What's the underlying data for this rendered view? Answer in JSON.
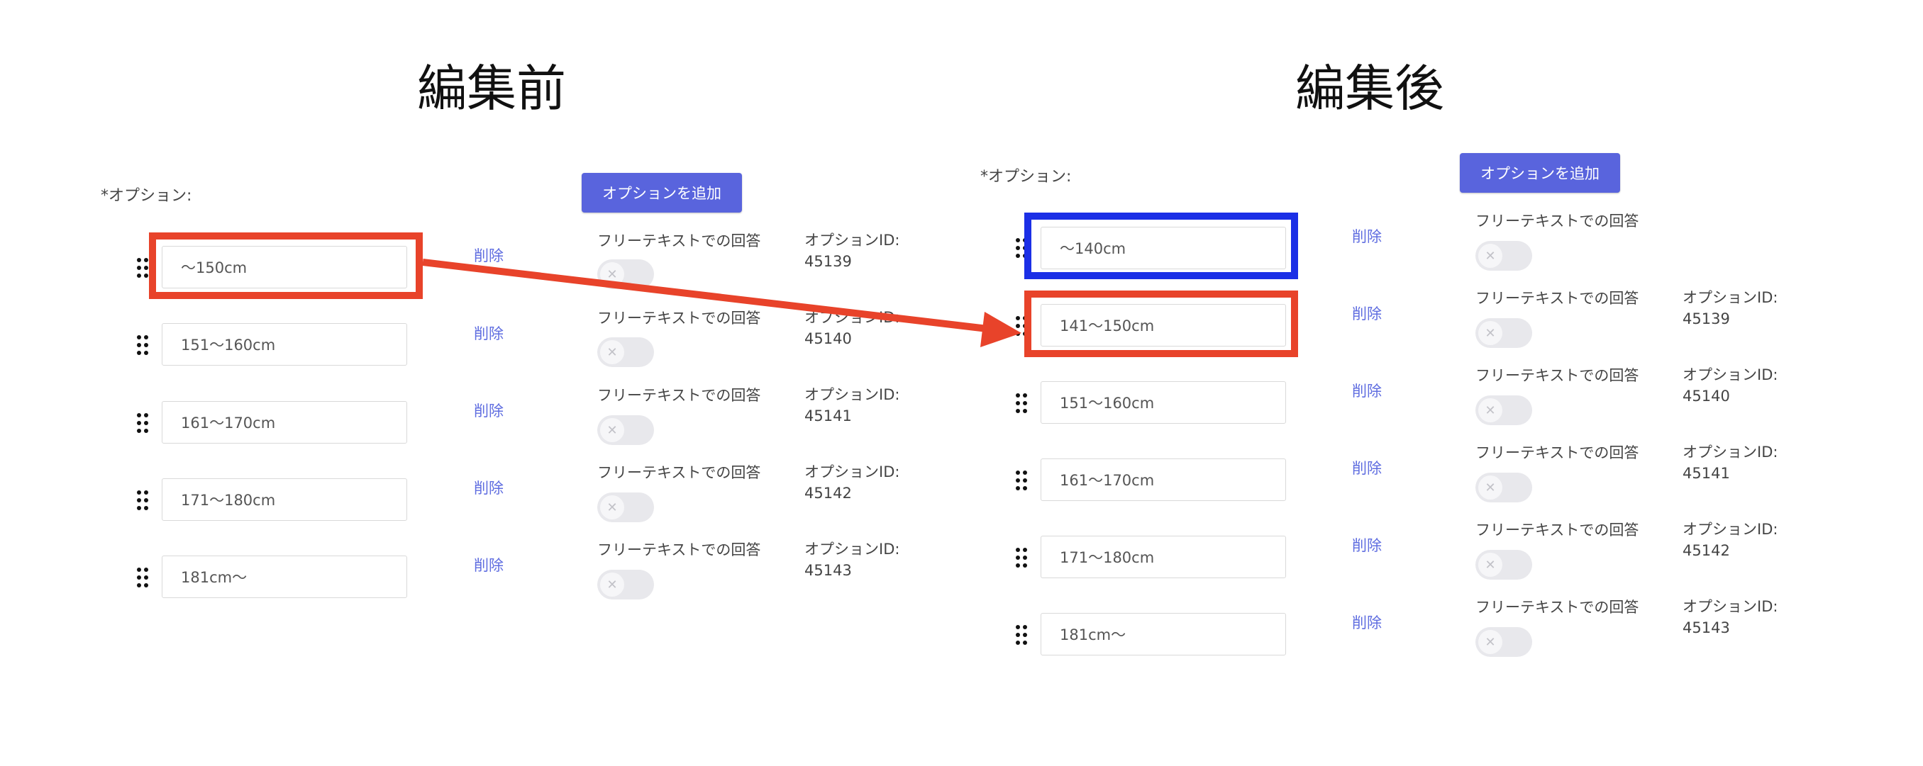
{
  "before": {
    "heading": "編集前",
    "options_label": "*オプション:",
    "add_button": "オプションを追加",
    "rows": [
      {
        "value": "〜150cm",
        "delete": "削除",
        "free_text": "フリーテキストでの回答",
        "option_id_label": "オプションID:",
        "option_id": "45139"
      },
      {
        "value": "151〜160cm",
        "delete": "削除",
        "free_text": "フリーテキストでの回答",
        "option_id_label": "オプションID:",
        "option_id": "45140"
      },
      {
        "value": "161〜170cm",
        "delete": "削除",
        "free_text": "フリーテキストでの回答",
        "option_id_label": "オプションID:",
        "option_id": "45141"
      },
      {
        "value": "171〜180cm",
        "delete": "削除",
        "free_text": "フリーテキストでの回答",
        "option_id_label": "オプションID:",
        "option_id": "45142"
      },
      {
        "value": "181cm〜",
        "delete": "削除",
        "free_text": "フリーテキストでの回答",
        "option_id_label": "オプションID:",
        "option_id": "45143"
      }
    ]
  },
  "after": {
    "heading": "編集後",
    "options_label": "*オプション:",
    "add_button": "オプションを追加",
    "rows": [
      {
        "value": "〜140cm",
        "delete": "削除",
        "free_text": "フリーテキストでの回答",
        "option_id_label": "",
        "option_id": ""
      },
      {
        "value": "141〜150cm",
        "delete": "削除",
        "free_text": "フリーテキストでの回答",
        "option_id_label": "オプションID:",
        "option_id": "45139"
      },
      {
        "value": "151〜160cm",
        "delete": "削除",
        "free_text": "フリーテキストでの回答",
        "option_id_label": "オプションID:",
        "option_id": "45140"
      },
      {
        "value": "161〜170cm",
        "delete": "削除",
        "free_text": "フリーテキストでの回答",
        "option_id_label": "オプションID:",
        "option_id": "45141"
      },
      {
        "value": "171〜180cm",
        "delete": "削除",
        "free_text": "フリーテキストでの回答",
        "option_id_label": "オプションID:",
        "option_id": "45142"
      },
      {
        "value": "181cm〜",
        "delete": "削除",
        "free_text": "フリーテキストでの回答",
        "option_id_label": "オプションID:",
        "option_id": "45143"
      }
    ]
  },
  "colors": {
    "accent_button": "#5964dd",
    "link": "#5f6de0",
    "highlight_red": "#e8432a",
    "highlight_blue": "#1b2fe6",
    "toggle_off": "#e8e8ec"
  },
  "icons": {
    "drag_handle": "drag-handle-icon",
    "toggle_knob": "close-x-icon"
  }
}
